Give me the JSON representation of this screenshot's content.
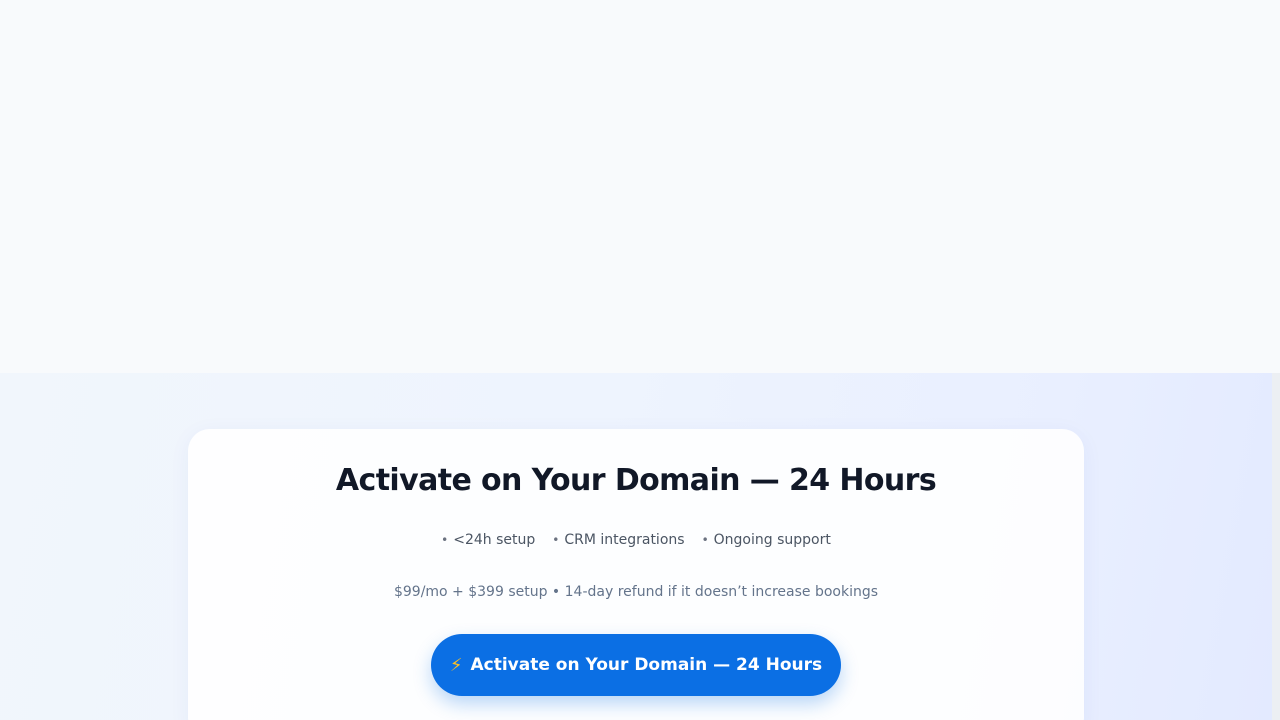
{
  "cta": {
    "title": "Activate on Your Domain — 24 Hours",
    "features": [
      {
        "bullet": "•",
        "label": "<24h setup"
      },
      {
        "bullet": "•",
        "label": "CRM integrations"
      },
      {
        "bullet": "•",
        "label": "Ongoing support"
      }
    ],
    "pricing": "$99/mo + $399 setup • 14-day refund if it doesn’t increase bookings",
    "button": {
      "icon": "⚡",
      "icon_name": "lightning-bolt-icon",
      "label": "Activate on Your Domain — 24 Hours"
    }
  },
  "colors": {
    "page_background": "#f8fafc",
    "accent": "#0b6fe4",
    "title": "#111827",
    "muted_text": "#64748b"
  }
}
